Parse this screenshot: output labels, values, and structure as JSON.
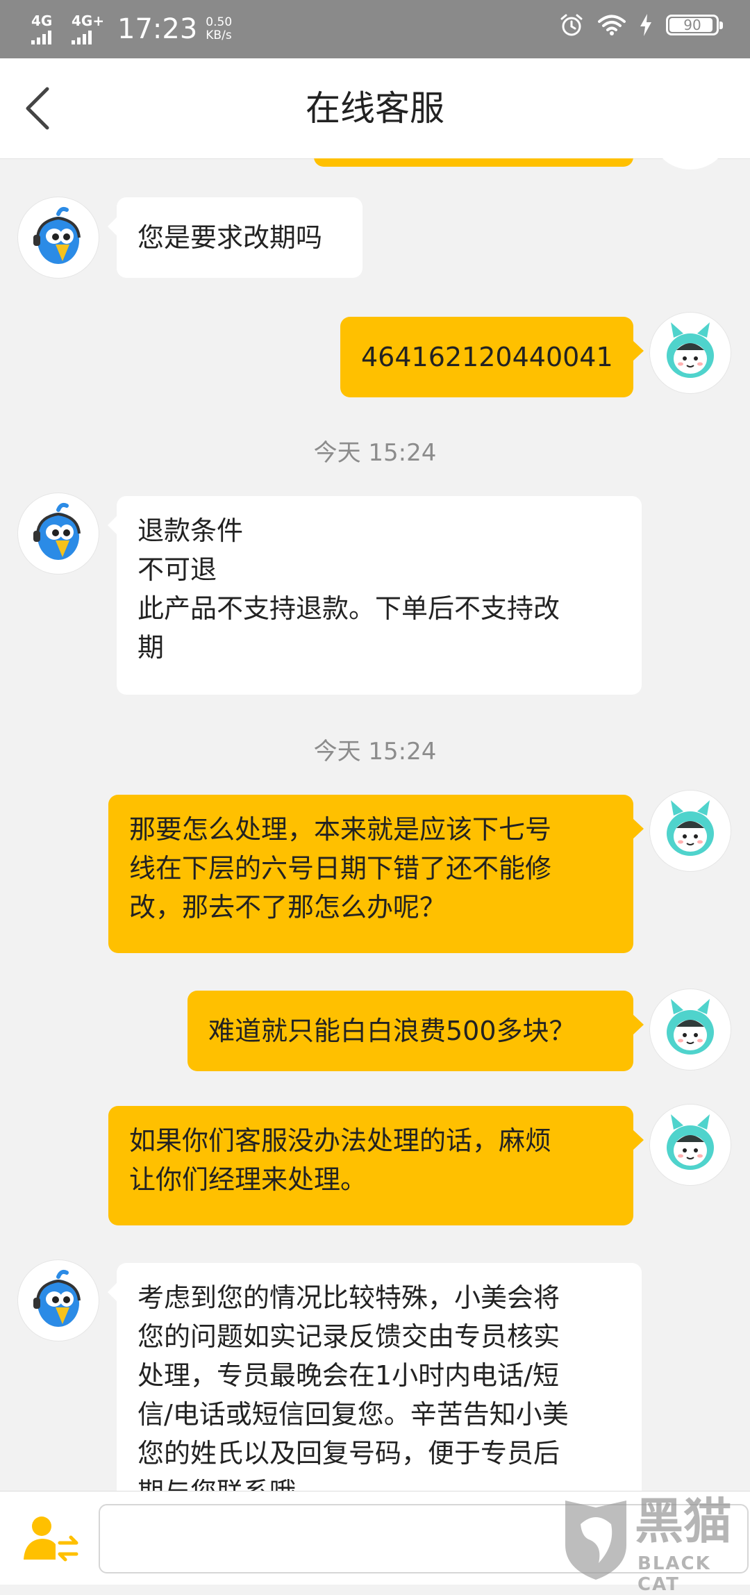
{
  "status_bar": {
    "signal1_label": "4G",
    "signal2_label": "4G+",
    "time": "17:23",
    "speed_value": "0.50",
    "speed_unit": "KB/s",
    "battery": "90",
    "icons": [
      "alarm-icon",
      "wifi-icon",
      "charging-icon",
      "battery-icon"
    ]
  },
  "header": {
    "title": "在线客服",
    "back_icon": "chevron-left-icon"
  },
  "messages": [
    {
      "from": "agent",
      "lines": [
        "您是要求改期吗"
      ]
    },
    {
      "from": "user",
      "lines": [
        "464162120440041"
      ]
    },
    {
      "type": "timestamp",
      "text": "今天 15:24"
    },
    {
      "from": "agent",
      "lines": [
        "退款条件",
        "不可退",
        "此产品不支持退款。下单后不支持改",
        "期"
      ]
    },
    {
      "type": "timestamp",
      "text": "今天 15:24"
    },
    {
      "from": "user",
      "lines": [
        "那要怎么处理，本来就是应该下七号",
        "线在下层的六号日期下错了还不能修",
        "改，那去不了那怎么办呢？"
      ]
    },
    {
      "from": "user",
      "lines": [
        "难道就只能白白浪费500多块？"
      ]
    },
    {
      "from": "user",
      "lines": [
        "如果你们客服没办法处理的话，麻烦",
        "让你们经理来处理。"
      ]
    },
    {
      "from": "agent",
      "lines": [
        "考虑到您的情况比较特殊，小美会将",
        "您的问题如实记录反馈交由专员核实",
        "处理，专员最晚会在1小时内电话/短",
        "信/电话或短信回复您。辛苦告知小美",
        "您的姓氏以及回复号码，便于专员后",
        "期与您联系哦"
      ]
    }
  ],
  "input_bar": {
    "switch_icon": "transfer-person-icon",
    "placeholder": ""
  },
  "watermark": {
    "logo": "black-cat-logo",
    "text_cn": "黑猫",
    "text_en": "BLACK CAT"
  },
  "colors": {
    "user_bubble": "#ffc000",
    "agent_bubble": "#ffffff",
    "background": "#f2f2f2",
    "status_bar": "#8a8a8a"
  }
}
